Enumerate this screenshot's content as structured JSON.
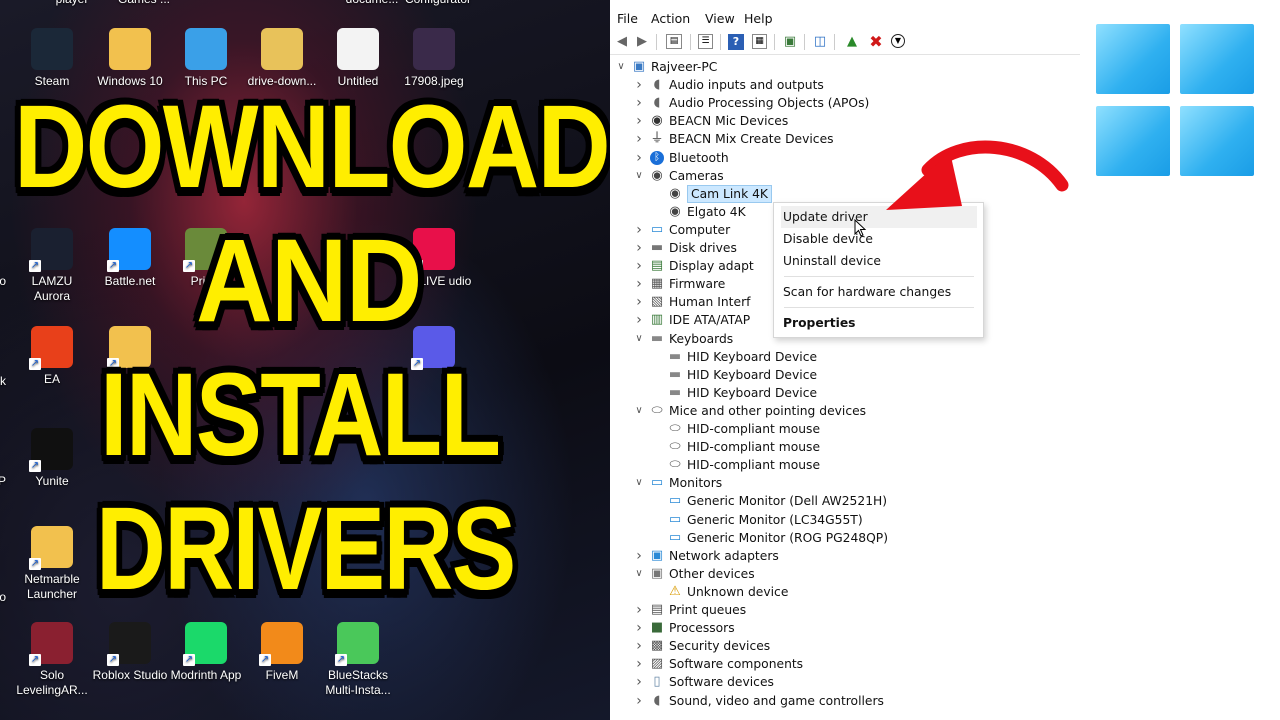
{
  "thumbnail": {
    "title_lines": [
      "DOWNLOAD",
      "AND",
      "INSTALL",
      "DRIVERS"
    ]
  },
  "desktop": {
    "top_row_partial": [
      "player",
      "Games ...",
      "docume...",
      "Configurator"
    ],
    "icons": [
      {
        "label": "Steam",
        "icon": "steam-icon",
        "color": "#1b2838"
      },
      {
        "label": "Windows 10",
        "icon": "folder-icon",
        "color": "#f2c14e"
      },
      {
        "label": "This PC",
        "icon": "monitor-icon",
        "color": "#3aa0e8"
      },
      {
        "label": "drive-down...",
        "icon": "folder-zip-icon",
        "color": "#e8c25a"
      },
      {
        "label": "Untitled",
        "icon": "pdf-icon",
        "color": "#f3f3f3"
      },
      {
        "label": "17908.jpeg",
        "icon": "image-icon",
        "color": "#3a2a4a"
      },
      {
        "label": "LAMZU Aurora",
        "icon": "lamzu-icon",
        "color": "#1a2030"
      },
      {
        "label": "Battle.net",
        "icon": "battlenet-icon",
        "color": "#148eff"
      },
      {
        "label": "Prism",
        "icon": "prism-icon",
        "color": "#6a8a3a"
      },
      {
        "label": "ook LIVE udio",
        "icon": "tiktok-live-icon",
        "color": "#e8104a"
      },
      {
        "label": "EA",
        "icon": "ea-icon",
        "color": "#e8401a"
      },
      {
        "label": "",
        "icon": "bolt-icon",
        "color": "#f2c14e"
      },
      {
        "label": "",
        "icon": "w-app-icon",
        "color": "#5a5ae8"
      },
      {
        "label": "Yunite",
        "icon": "yunite-icon",
        "color": "#101010"
      },
      {
        "label": "Netmarble Launcher",
        "icon": "netmarble-icon",
        "color": "#f2c14e"
      },
      {
        "label": "Solo LevelingAR...",
        "icon": "solo-leveling-icon",
        "color": "#8a2030"
      },
      {
        "label": "Roblox Studio",
        "icon": "roblox-studio-icon",
        "color": "#1a1a1a"
      },
      {
        "label": "Modrinth App",
        "icon": "modrinth-icon",
        "color": "#1bd96a"
      },
      {
        "label": "FiveM",
        "icon": "fivem-icon",
        "color": "#f28a1a"
      },
      {
        "label": "BlueStacks Multi-Insta...",
        "icon": "bluestacks-icon",
        "color": "#4ac85a"
      }
    ],
    "edge_labels": [
      "o",
      "ck",
      "P",
      "o"
    ]
  },
  "device_manager": {
    "menu": [
      "File",
      "Action",
      "View",
      "Help"
    ],
    "toolbar_icons": [
      "back-icon",
      "forward-icon",
      "properties-icon",
      "list-icon",
      "help-icon",
      "view-icon",
      "update-driver-icon",
      "monitor-icon",
      "enable-device-icon",
      "uninstall-icon",
      "download-icon"
    ],
    "tree": [
      {
        "label": "Rajveer-PC",
        "level": 0,
        "expanded": true,
        "icon": "computer-icon"
      },
      {
        "label": "Audio inputs and outputs",
        "level": 1,
        "expanded": false,
        "icon": "speaker-icon"
      },
      {
        "label": "Audio Processing Objects (APOs)",
        "level": 1,
        "expanded": false,
        "icon": "speaker-icon"
      },
      {
        "label": "BEACN Mic Devices",
        "level": 1,
        "expanded": false,
        "icon": "mic-icon"
      },
      {
        "label": "BEACN Mix Create Devices",
        "level": 1,
        "expanded": false,
        "icon": "usb-icon"
      },
      {
        "label": "Bluetooth",
        "level": 1,
        "expanded": false,
        "icon": "bluetooth-icon"
      },
      {
        "label": "Cameras",
        "level": 1,
        "expanded": true,
        "icon": "camera-icon"
      },
      {
        "label": "Cam Link 4K",
        "level": 2,
        "selected": true,
        "icon": "camera-icon"
      },
      {
        "label": "Elgato 4K",
        "level": 2,
        "icon": "camera-icon"
      },
      {
        "label": "Computer",
        "level": 1,
        "expanded": false,
        "icon": "monitor-icon"
      },
      {
        "label": "Disk drives",
        "level": 1,
        "expanded": false,
        "icon": "disk-icon"
      },
      {
        "label": "Display adapt",
        "level": 1,
        "expanded": false,
        "icon": "display-adapter-icon"
      },
      {
        "label": "Firmware",
        "level": 1,
        "expanded": false,
        "icon": "firmware-icon"
      },
      {
        "label": "Human Interf",
        "level": 1,
        "expanded": false,
        "icon": "hid-icon"
      },
      {
        "label": "IDE ATA/ATAP",
        "level": 1,
        "expanded": false,
        "icon": "ide-icon"
      },
      {
        "label": "Keyboards",
        "level": 1,
        "expanded": true,
        "icon": "keyboard-icon"
      },
      {
        "label": "HID Keyboard Device",
        "level": 2,
        "icon": "keyboard-icon"
      },
      {
        "label": "HID Keyboard Device",
        "level": 2,
        "icon": "keyboard-icon"
      },
      {
        "label": "HID Keyboard Device",
        "level": 2,
        "icon": "keyboard-icon"
      },
      {
        "label": "Mice and other pointing devices",
        "level": 1,
        "expanded": true,
        "icon": "mouse-icon"
      },
      {
        "label": "HID-compliant mouse",
        "level": 2,
        "icon": "mouse-icon"
      },
      {
        "label": "HID-compliant mouse",
        "level": 2,
        "icon": "mouse-icon"
      },
      {
        "label": "HID-compliant mouse",
        "level": 2,
        "icon": "mouse-icon"
      },
      {
        "label": "Monitors",
        "level": 1,
        "expanded": true,
        "icon": "monitor-icon"
      },
      {
        "label": "Generic Monitor (Dell AW2521H)",
        "level": 2,
        "icon": "monitor-icon"
      },
      {
        "label": "Generic Monitor (LC34G55T)",
        "level": 2,
        "icon": "monitor-icon"
      },
      {
        "label": "Generic Monitor (ROG PG248QP)",
        "level": 2,
        "icon": "monitor-icon"
      },
      {
        "label": "Network adapters",
        "level": 1,
        "expanded": false,
        "icon": "network-icon"
      },
      {
        "label": "Other devices",
        "level": 1,
        "expanded": true,
        "icon": "other-devices-icon"
      },
      {
        "label": "Unknown device",
        "level": 2,
        "icon": "warning-device-icon"
      },
      {
        "label": "Print queues",
        "level": 1,
        "expanded": false,
        "icon": "printer-icon"
      },
      {
        "label": "Processors",
        "level": 1,
        "expanded": false,
        "icon": "processor-icon"
      },
      {
        "label": "Security devices",
        "level": 1,
        "expanded": false,
        "icon": "security-icon"
      },
      {
        "label": "Software components",
        "level": 1,
        "expanded": false,
        "icon": "software-component-icon"
      },
      {
        "label": "Software devices",
        "level": 1,
        "expanded": false,
        "icon": "software-device-icon"
      },
      {
        "label": "Sound, video and game controllers",
        "level": 1,
        "expanded": false,
        "icon": "speaker-icon"
      }
    ],
    "context_menu": {
      "update": "Update driver",
      "disable": "Disable device",
      "uninstall": "Uninstall device",
      "scan": "Scan for hardware changes",
      "properties": "Properties"
    }
  },
  "colors": {
    "title_yellow": "#ffee00",
    "arrow_red": "#e8101a",
    "selection": "#cce8ff",
    "win_blue": "#1a9de6"
  }
}
